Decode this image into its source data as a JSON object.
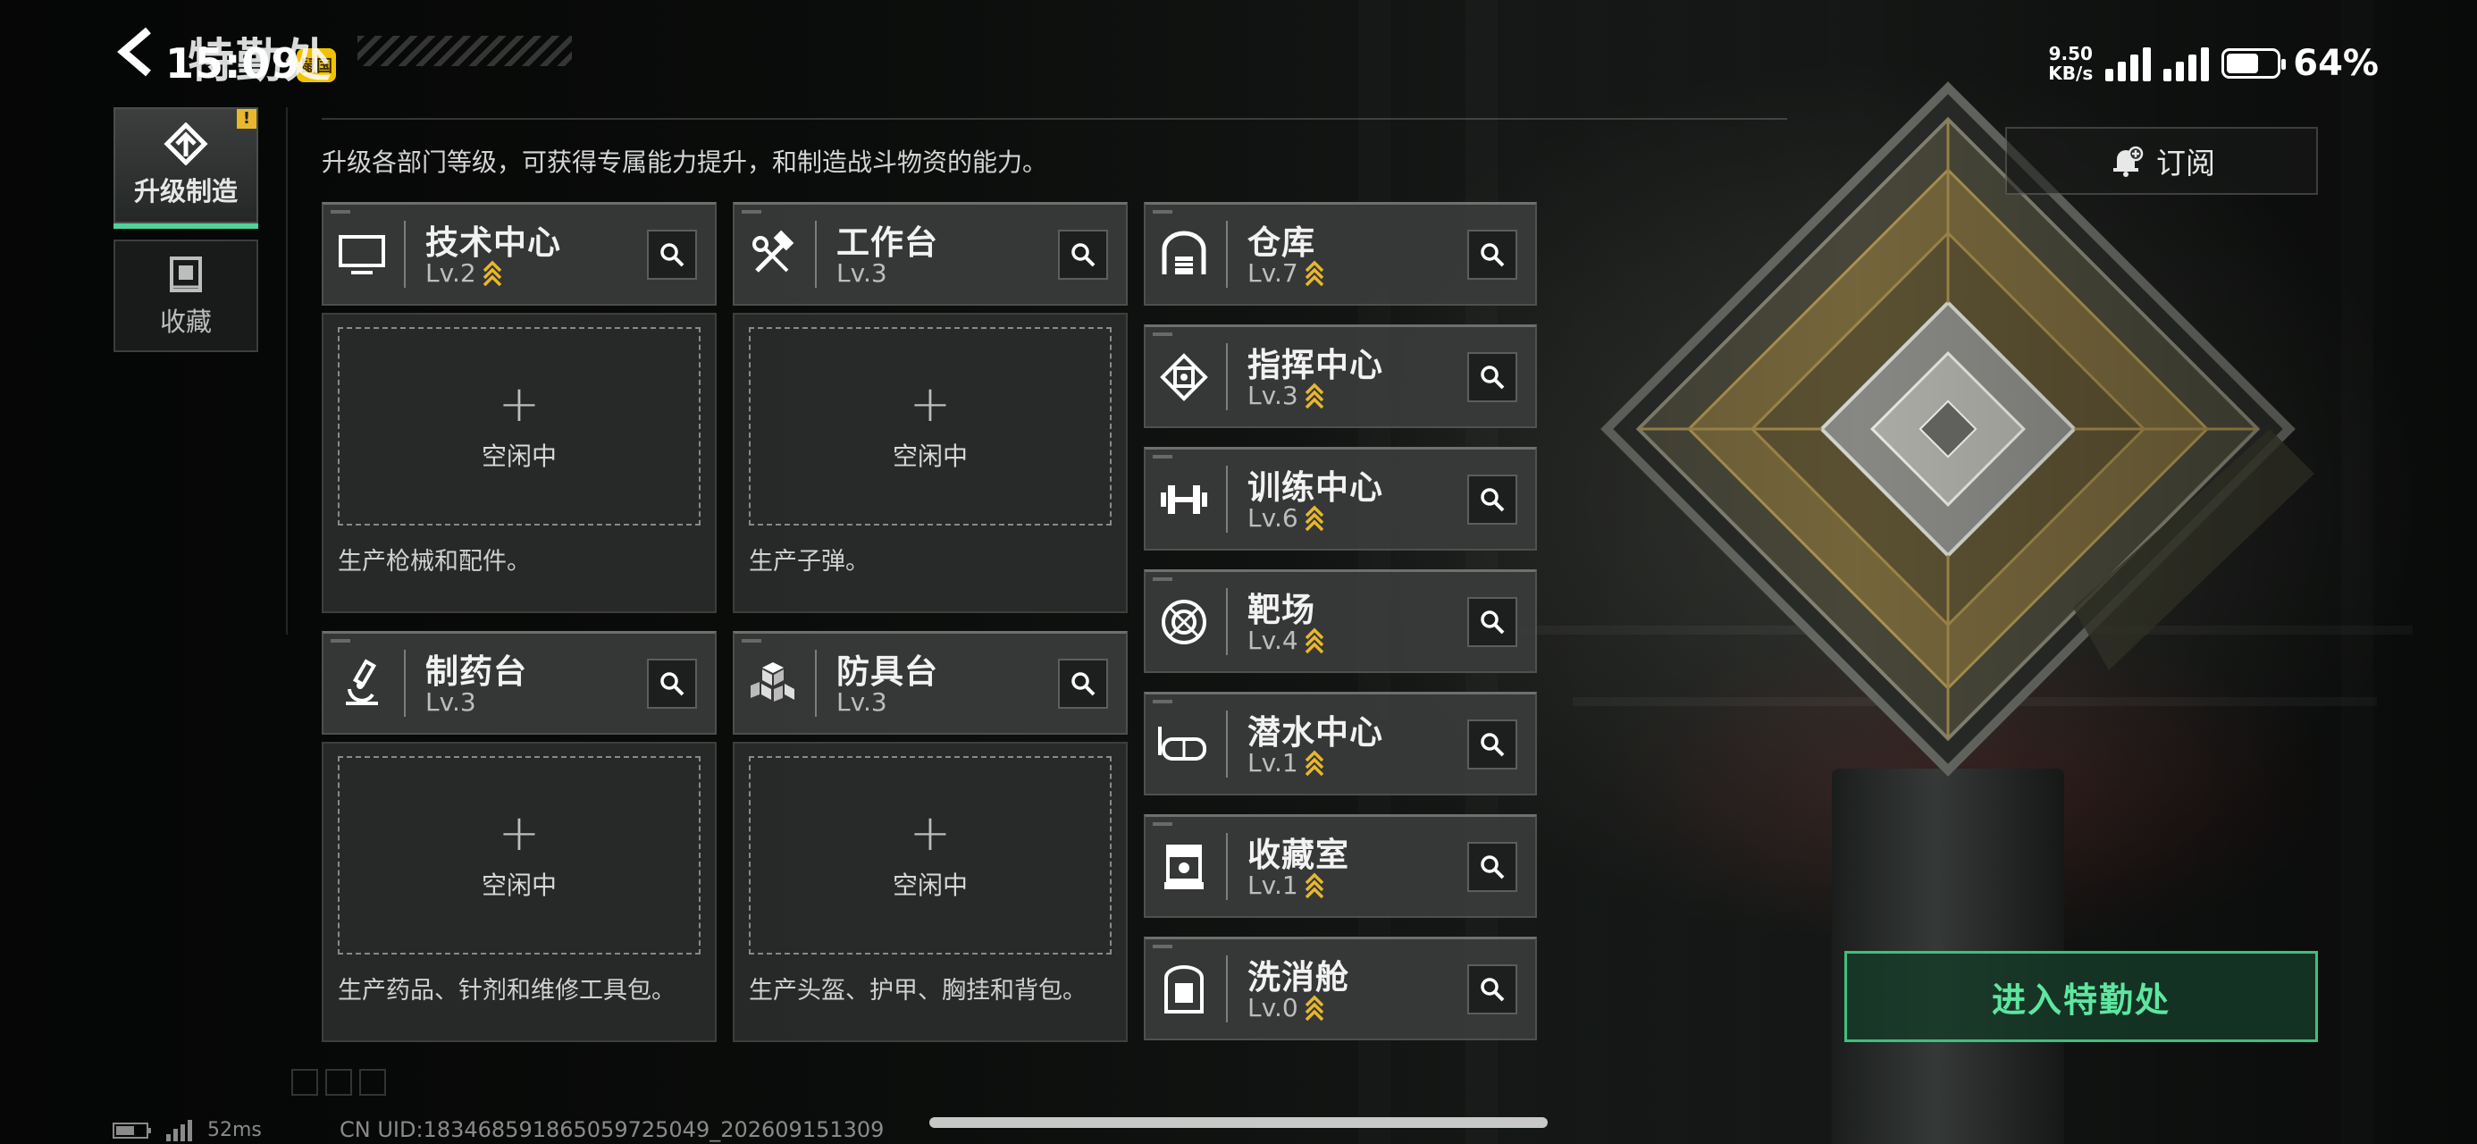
{
  "status_bar": {
    "time": "15:09",
    "badge": "鼠国",
    "net_speed": "9.50",
    "net_unit": "KB/s",
    "battery_percent": "64%",
    "battery_level": 0.64
  },
  "header": {
    "title": "特勤处",
    "subtitle": "升级各部门等级，可获得专属能力提升，和制造战斗物资的能力。"
  },
  "sidebar": {
    "items": [
      {
        "label": "升级制造",
        "icon": "upgrade-icon",
        "active": true,
        "alert": "!"
      },
      {
        "label": "收藏",
        "icon": "collection-icon",
        "active": false
      }
    ]
  },
  "production": [
    {
      "name": "技术中心",
      "level": "Lv.2",
      "icon": "monitor-icon",
      "upgradable": true,
      "slot_status": "空闲中",
      "slot_plus": "+",
      "description": "生产枪械和配件。"
    },
    {
      "name": "工作台",
      "level": "Lv.3",
      "icon": "tools-icon",
      "upgradable": false,
      "slot_status": "空闲中",
      "slot_plus": "+",
      "description": "生产子弹。"
    },
    {
      "name": "制药台",
      "level": "Lv.3",
      "icon": "microscope-icon",
      "upgradable": false,
      "slot_status": "空闲中",
      "slot_plus": "+",
      "description": "生产药品、针剂和维修工具包。"
    },
    {
      "name": "防具台",
      "level": "Lv.3",
      "icon": "cubes-icon",
      "upgradable": false,
      "slot_status": "空闲中",
      "slot_plus": "+",
      "description": "生产头盔、护甲、胸挂和背包。"
    }
  ],
  "facilities": [
    {
      "name": "仓库",
      "level": "Lv.7",
      "icon": "warehouse-icon",
      "upgradable": true
    },
    {
      "name": "指挥中心",
      "level": "Lv.3",
      "icon": "command-center-icon",
      "upgradable": true
    },
    {
      "name": "训练中心",
      "level": "Lv.6",
      "icon": "dumbbell-icon",
      "upgradable": true
    },
    {
      "name": "靶场",
      "level": "Lv.4",
      "icon": "target-icon",
      "upgradable": true
    },
    {
      "name": "潜水中心",
      "level": "Lv.1",
      "icon": "diving-mask-icon",
      "upgradable": true
    },
    {
      "name": "收藏室",
      "level": "Lv.1",
      "icon": "display-case-icon",
      "upgradable": true
    },
    {
      "name": "洗消舱",
      "level": "Lv.0",
      "icon": "decon-chamber-icon",
      "upgradable": true
    }
  ],
  "buttons": {
    "subscribe": "订阅",
    "enter": "进入特勤处"
  },
  "footer": {
    "ping": "52ms",
    "uid": "CN UID:1834685918650597250​49_202609151309"
  },
  "colors": {
    "accent_green": "#4fd39a",
    "upgrade_gold": "#e8b72c",
    "card_bg": "#3a3c3b"
  }
}
